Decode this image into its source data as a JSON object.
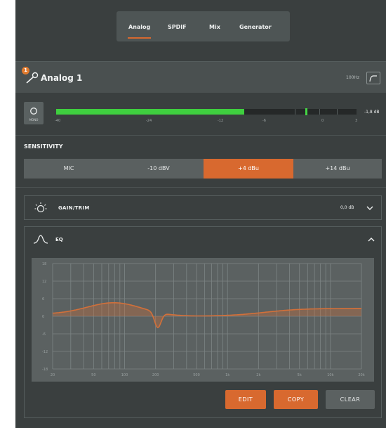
{
  "tabs": [
    {
      "label": "Analog",
      "active": true
    },
    {
      "label": "SPDIF",
      "active": false
    },
    {
      "label": "Mix",
      "active": false
    },
    {
      "label": "Generator",
      "active": false
    }
  ],
  "channel": {
    "badge": "1",
    "title": "Analog 1",
    "hz_label": "100Hz"
  },
  "meter": {
    "mono_label": "MONO",
    "level_fraction": 0.625,
    "peak_fraction": 0.83,
    "value_label": "-1,8 dB",
    "scale": [
      "-40",
      "-24",
      "-12",
      "-6",
      "0",
      "3"
    ],
    "color": "#3fcf3f"
  },
  "sensitivity": {
    "title": "SENSITIVITY",
    "options": [
      "MIC",
      "-10 dBV",
      "+4 dBu",
      "+14 dBu"
    ],
    "selected": "+4 dBu"
  },
  "gain": {
    "title": "GAIN/TRIM",
    "value": "0,0 dB"
  },
  "eq": {
    "title": "EQ",
    "y_ticks": [
      "18",
      "12",
      "6",
      "0",
      "-6",
      "-12",
      "-18"
    ],
    "x_ticks": [
      "20",
      "50",
      "100",
      "200",
      "500",
      "1k",
      "2k",
      "5k",
      "10k",
      "20k"
    ],
    "curve_color": "#d2703a"
  },
  "buttons": {
    "edit": "EDIT",
    "copy": "COPY",
    "clear": "CLEAR"
  },
  "colors": {
    "accent": "#d8692f",
    "background": "#3a3f3f"
  }
}
